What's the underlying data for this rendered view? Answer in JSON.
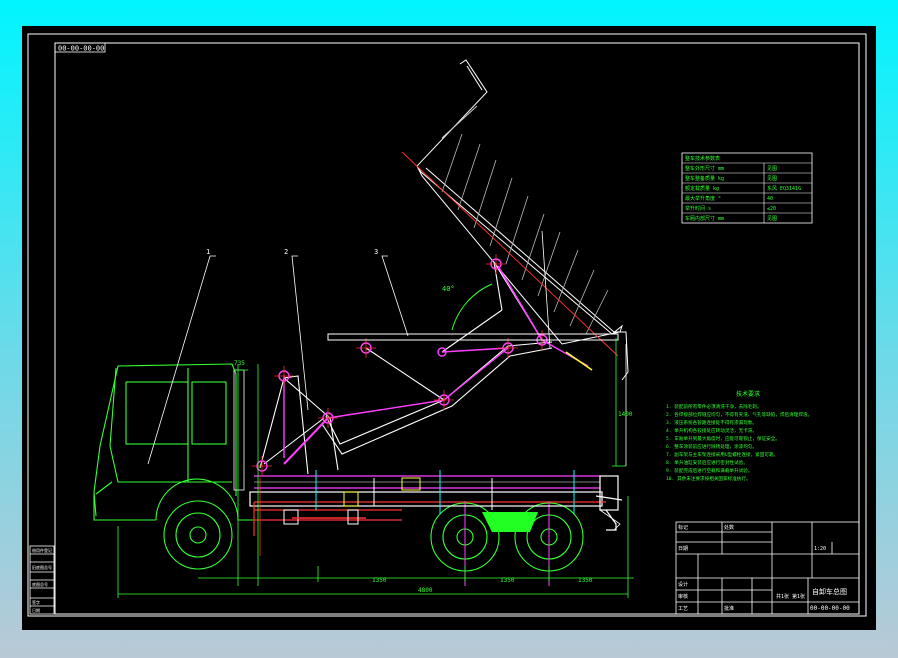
{
  "drawing": {
    "code_stamp": "00-00-00-00",
    "part_numbers": [
      "1",
      "2",
      "3"
    ],
    "angle_label": "40°",
    "dimensions": {
      "left_top": "735",
      "right_height": "1400",
      "bottom_a": "1350",
      "bottom_b": "1350",
      "bottom_c": "1350",
      "overall": "4800"
    }
  },
  "tech_table": {
    "rows": [
      {
        "label": "整车技术参数表",
        "value": ""
      },
      {
        "label": "整车外形尺寸 mm",
        "value": "见图"
      },
      {
        "label": "整车整备质量 kg",
        "value": "见图"
      },
      {
        "label": "额定载质量 kg",
        "value": "东风 EQ3141G"
      },
      {
        "label": "最大举升角度 °",
        "value": "40"
      },
      {
        "label": "举升时间 s",
        "value": "≤20"
      },
      {
        "label": "车厢内部尺寸 mm",
        "value": "见图"
      }
    ]
  },
  "notes": {
    "title": "技术要求",
    "lines": [
      "1. 装配前所有零件必须清洗干净，去除毛刺。",
      "2. 各焊接部位焊缝应均匀，不得有夹渣、气孔等缺陷，焊后清理焊渣。",
      "3. 液压系统各管路连接处不得有渗漏现象。",
      "4. 举升机构各铰接处应转动灵活，无卡滞。",
      "5. 车厢举升到最大角度时，应能可靠锁止，保证安全。",
      "6. 整车涂装前应进行除锈处理，涂漆均匀。",
      "7. 副车架与主车架连接采用U型螺栓连接，紧固可靠。",
      "8. 举升油缸安装后应进行密封性试验。",
      "9. 装配完成后进行空载和满载举升试验。",
      "10. 其余未注要求按相关国家标准执行。"
    ]
  },
  "title_block": {
    "drawing_name": "自卸车总图",
    "code": "00-00-00-00",
    "scale": "1:20",
    "sheet": "共1张 第1张",
    "labels": {
      "designed": "设计",
      "checked": "审核",
      "process": "工艺",
      "approved": "批准",
      "mark": "标记",
      "count": "处数",
      "date": "日期"
    }
  },
  "left_block": {
    "cells": [
      "借用件登记",
      "",
      "旧底图总号",
      "",
      "底图总号",
      "",
      "签字",
      "日期"
    ]
  }
}
